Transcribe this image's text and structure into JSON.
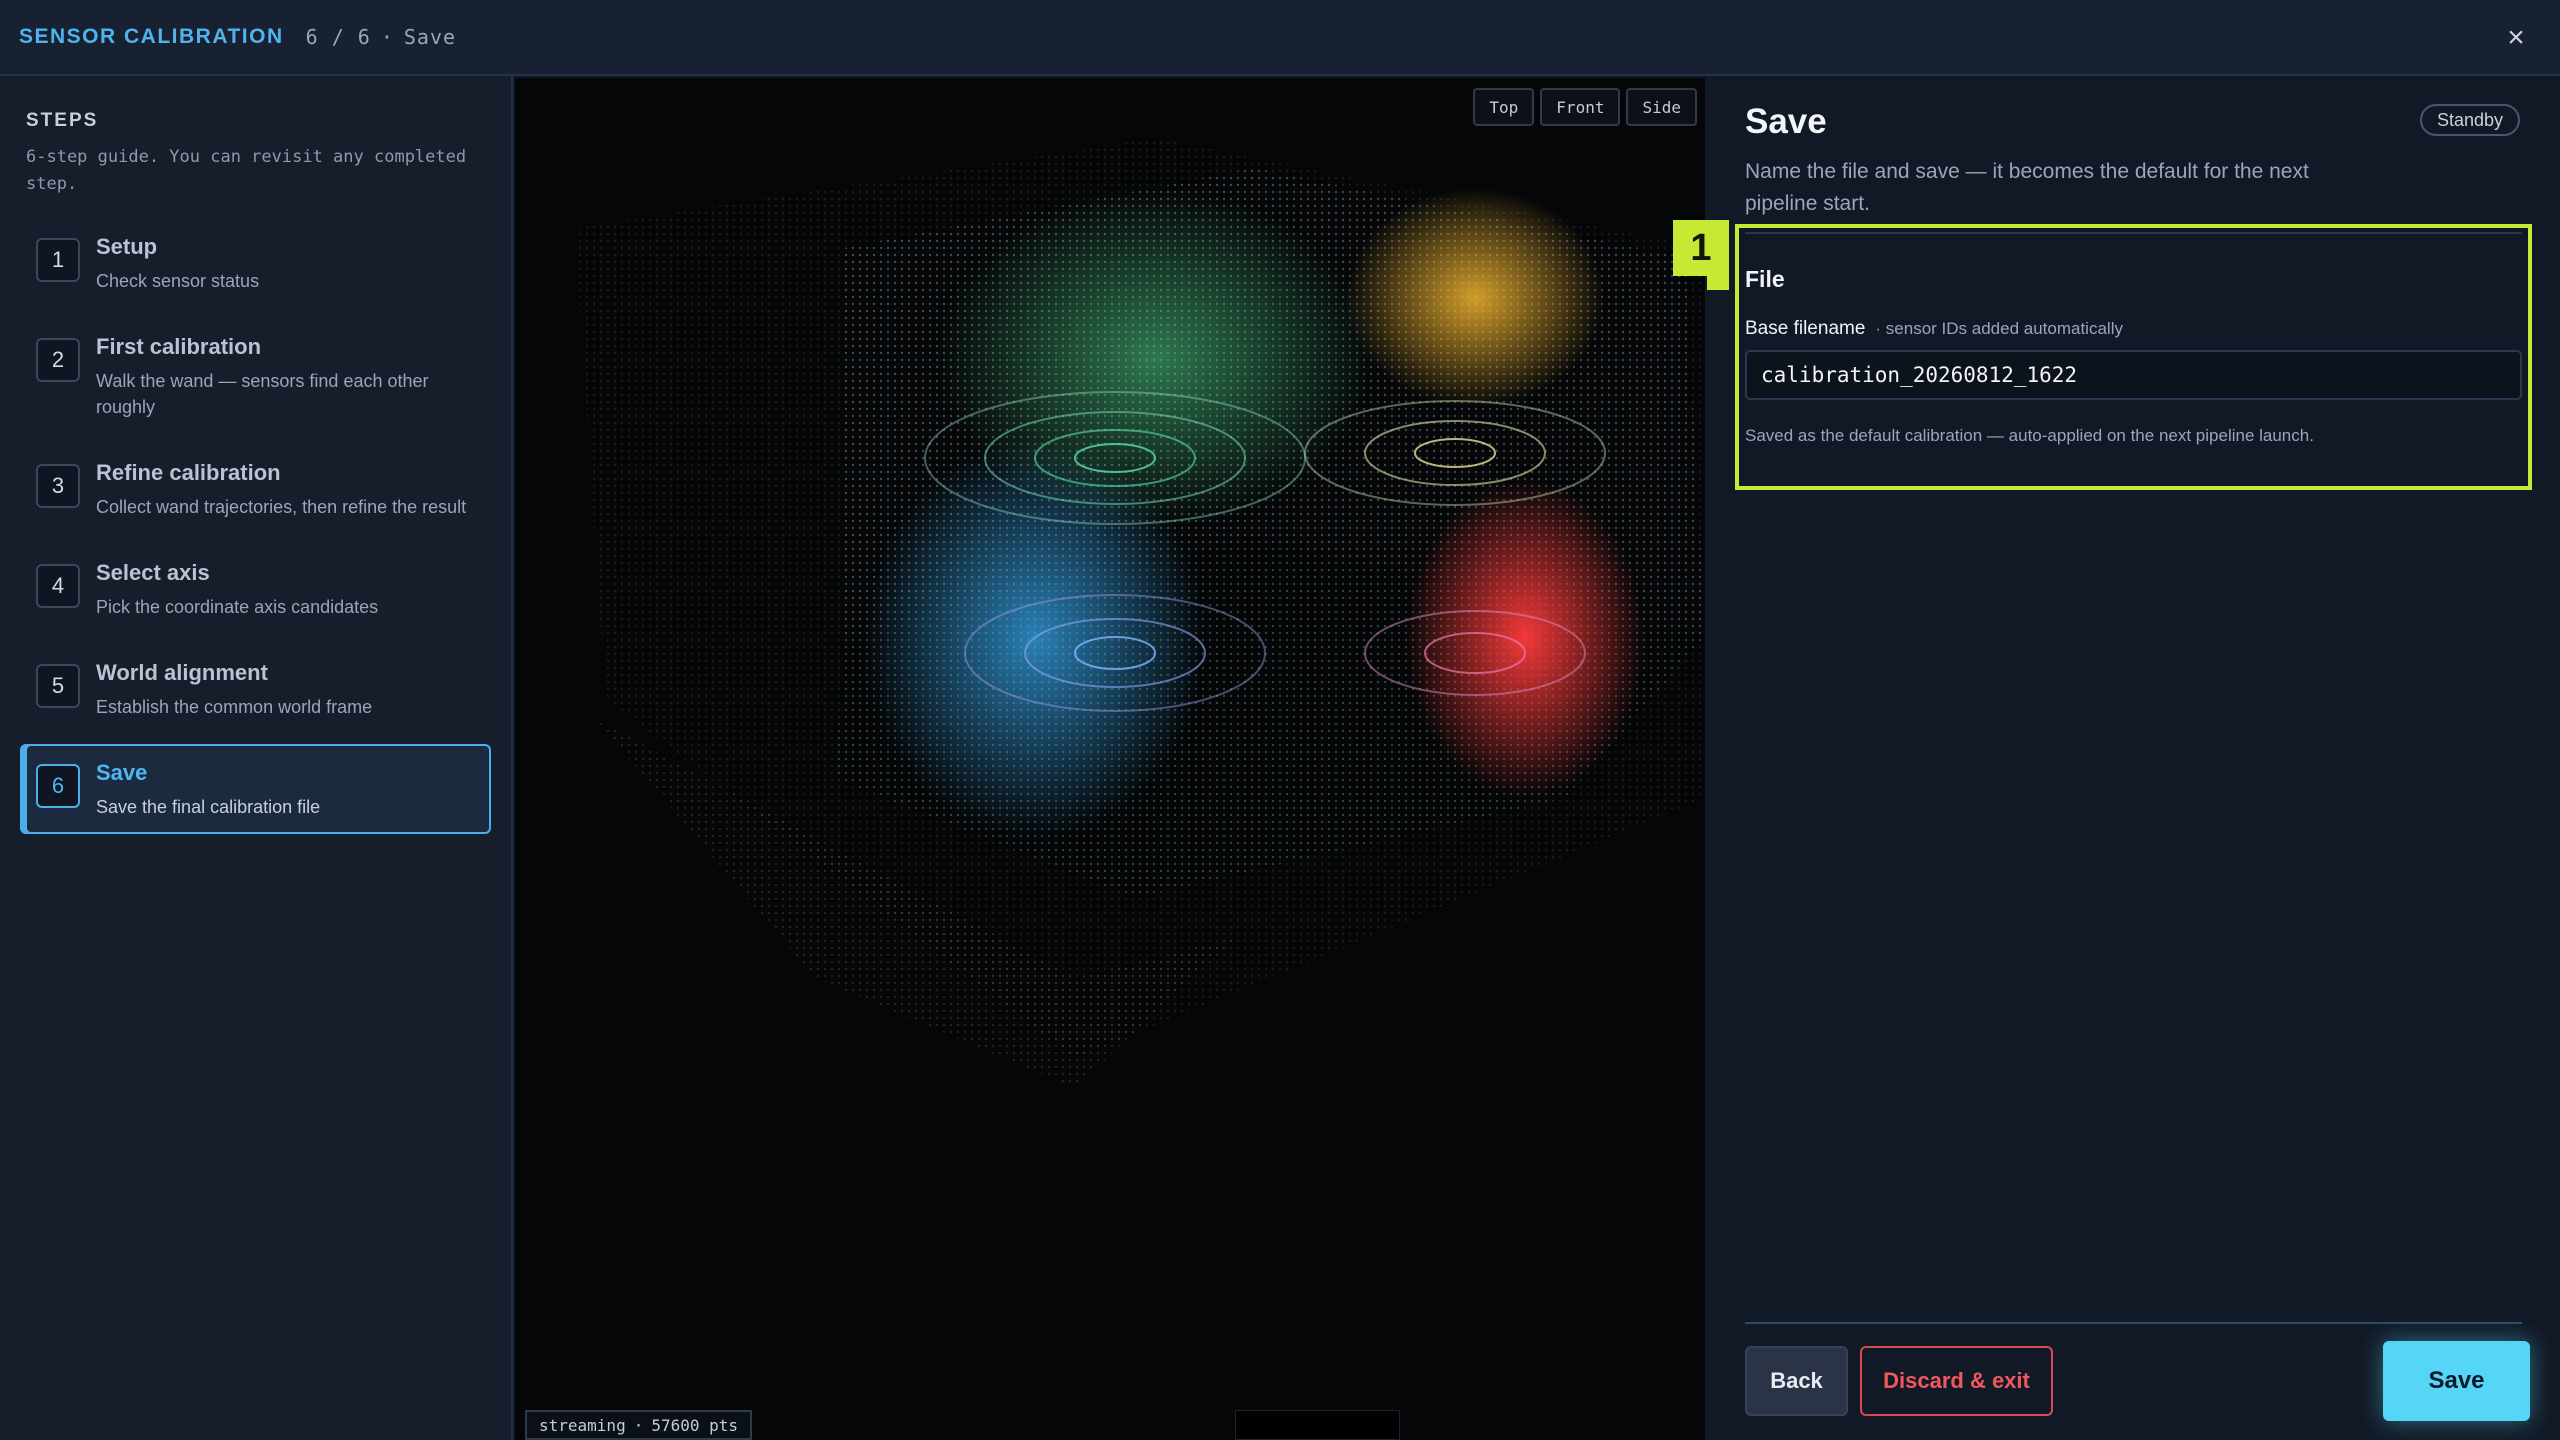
{
  "header": {
    "app_title": "SENSOR CALIBRATION",
    "progress": "6 / 6",
    "current_step": "Save",
    "separator": "·",
    "close_symbol": "×"
  },
  "sidebar": {
    "heading": "STEPS",
    "description": "6-step guide. You can revisit any completed step.",
    "steps": [
      {
        "number": "1",
        "label": "Setup",
        "sub": "Check sensor status"
      },
      {
        "number": "2",
        "label": "First calibration",
        "sub": "Walk the wand — sensors find each other roughly"
      },
      {
        "number": "3",
        "label": "Refine calibration",
        "sub": "Collect wand trajectories, then refine the result"
      },
      {
        "number": "4",
        "label": "Select axis",
        "sub": "Pick the coordinate axis candidates"
      },
      {
        "number": "5",
        "label": "World alignment",
        "sub": "Establish the common world frame"
      },
      {
        "number": "6",
        "label": "Save",
        "sub": "Save the final calibration file"
      }
    ],
    "active_step": 6
  },
  "viewport": {
    "view_buttons": [
      "Top",
      "Front",
      "Side"
    ],
    "status": "streaming",
    "point_count": "57600 pts",
    "separator": "·"
  },
  "panel": {
    "title": "Save",
    "mode_badge": "Standby",
    "description": "Name the file and save — it becomes the default for the next pipeline start.",
    "callout_number": "1",
    "section_title": "File",
    "field_label": "Base filename",
    "field_hint": "· sensor IDs added automatically",
    "filename_value": "calibration_20260812_1622",
    "field_note": "Saved as the default calibration — auto-applied on the next pipeline launch.",
    "buttons": {
      "back": "Back",
      "discard": "Discard & exit",
      "save": "Save"
    }
  },
  "colors": {
    "accent": "#4fb3ee",
    "callout": "#c6ea34",
    "save_button": "#55d6f6",
    "discard": "#f2575c"
  }
}
